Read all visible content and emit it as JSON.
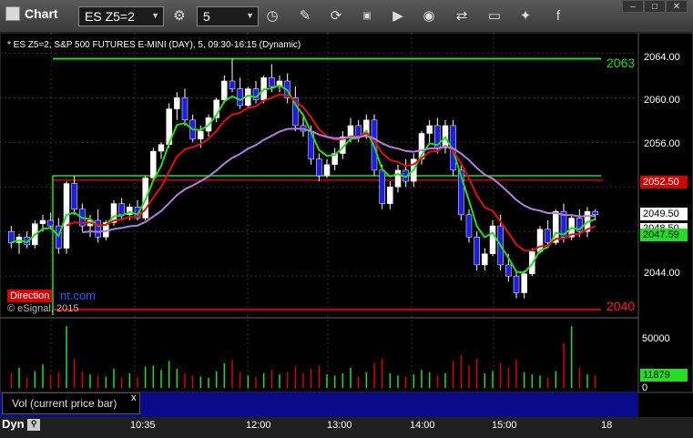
{
  "toolbar": {
    "title": "Chart",
    "symbol": "ES Z5=2",
    "interval": "5"
  },
  "chart": {
    "header": "* ES Z5=2, S&P 500 FUTURES E-MINI (DAY), 5, 09:30-16:15 (Dynamic)",
    "direction_label": "Direction",
    "direction_link": "nt.com",
    "copyright": "© eSignal, 2015",
    "right_labels": {
      "top": "2063",
      "bottom": "2040"
    },
    "price_axis": [
      "2064.00",
      "2060.00",
      "2056.00",
      "2044.00"
    ],
    "badges": [
      {
        "text": "2052.50",
        "bg": "#d40000",
        "fg": "#ffffff"
      },
      {
        "text": "2049.50",
        "bg": "#ffffff",
        "fg": "#000000"
      },
      {
        "text": "2048.50",
        "bg": "#ffffff",
        "fg": "#000000"
      },
      {
        "text": "2047.59",
        "bg": "#22dd22",
        "fg": "#000000"
      }
    ],
    "time_axis": [
      "10:35",
      "12:00",
      "13:00",
      "14:00",
      "15:00",
      "18"
    ]
  },
  "volume": {
    "label": "Vol (current price bar)",
    "close": "x",
    "axis": [
      "50000",
      "0"
    ],
    "badge": "11879"
  },
  "bottom": {
    "dyn": "Dyn"
  },
  "chart_data": {
    "type": "candlestick",
    "ylim": [
      2040.5,
      2065.5
    ],
    "candles": [
      [
        2048.0,
        2048.5,
        2046.5,
        2047.0
      ],
      [
        2047.0,
        2047.8,
        2046.0,
        2047.5
      ],
      [
        2047.5,
        2048.0,
        2046.5,
        2046.8
      ],
      [
        2046.8,
        2049.0,
        2046.5,
        2048.7
      ],
      [
        2048.7,
        2049.5,
        2048.0,
        2049.0
      ],
      [
        2049.0,
        2049.7,
        2048.2,
        2048.5
      ],
      [
        2048.5,
        2049.2,
        2046.0,
        2046.5
      ],
      [
        2046.5,
        2052.5,
        2046.0,
        2052.3
      ],
      [
        2052.3,
        2053.0,
        2049.5,
        2050.0
      ],
      [
        2050.0,
        2050.5,
        2048.0,
        2048.5
      ],
      [
        2048.5,
        2049.5,
        2047.5,
        2049.0
      ],
      [
        2049.0,
        2050.0,
        2047.0,
        2047.5
      ],
      [
        2047.5,
        2049.0,
        2047.2,
        2048.8
      ],
      [
        2048.8,
        2050.8,
        2048.5,
        2050.5
      ],
      [
        2050.5,
        2051.0,
        2049.0,
        2049.5
      ],
      [
        2049.5,
        2050.5,
        2049.0,
        2050.2
      ],
      [
        2050.2,
        2050.8,
        2049.0,
        2049.2
      ],
      [
        2049.2,
        2053.0,
        2049.0,
        2052.8
      ],
      [
        2052.8,
        2055.5,
        2052.5,
        2055.2
      ],
      [
        2055.2,
        2056.0,
        2054.5,
        2055.8
      ],
      [
        2055.8,
        2059.5,
        2055.5,
        2059.0
      ],
      [
        2059.0,
        2060.5,
        2058.0,
        2060.0
      ],
      [
        2060.0,
        2060.8,
        2057.5,
        2058.0
      ],
      [
        2058.0,
        2058.5,
        2056.0,
        2056.3
      ],
      [
        2056.3,
        2057.5,
        2055.5,
        2057.0
      ],
      [
        2057.0,
        2058.5,
        2056.5,
        2058.2
      ],
      [
        2058.2,
        2060.0,
        2057.8,
        2059.8
      ],
      [
        2059.8,
        2062.0,
        2059.5,
        2061.5
      ],
      [
        2061.5,
        2063.5,
        2060.5,
        2060.8
      ],
      [
        2060.8,
        2061.8,
        2059.0,
        2059.3
      ],
      [
        2059.3,
        2061.0,
        2059.0,
        2060.8
      ],
      [
        2060.8,
        2061.5,
        2059.5,
        2059.8
      ],
      [
        2059.8,
        2062.0,
        2059.5,
        2061.8
      ],
      [
        2061.8,
        2063.0,
        2060.5,
        2061.0
      ],
      [
        2061.0,
        2062.0,
        2060.5,
        2061.5
      ],
      [
        2061.5,
        2062.2,
        2059.5,
        2060.0
      ],
      [
        2060.0,
        2061.0,
        2057.0,
        2057.5
      ],
      [
        2057.5,
        2058.5,
        2056.5,
        2057.0
      ],
      [
        2057.0,
        2057.5,
        2054.0,
        2054.5
      ],
      [
        2054.5,
        2055.0,
        2052.5,
        2053.0
      ],
      [
        2053.0,
        2054.5,
        2052.8,
        2054.0
      ],
      [
        2054.0,
        2055.5,
        2053.5,
        2055.0
      ],
      [
        2055.0,
        2057.0,
        2054.5,
        2056.5
      ],
      [
        2056.5,
        2058.2,
        2056.0,
        2057.5
      ],
      [
        2057.5,
        2058.0,
        2056.0,
        2056.5
      ],
      [
        2056.5,
        2058.5,
        2056.3,
        2058.0
      ],
      [
        2058.0,
        2058.5,
        2053.0,
        2053.5
      ],
      [
        2053.5,
        2054.0,
        2050.0,
        2050.5
      ],
      [
        2050.5,
        2052.5,
        2050.0,
        2052.0
      ],
      [
        2052.0,
        2054.0,
        2051.5,
        2053.5
      ],
      [
        2053.5,
        2054.5,
        2052.0,
        2052.5
      ],
      [
        2052.5,
        2055.0,
        2052.0,
        2054.5
      ],
      [
        2054.5,
        2057.0,
        2054.0,
        2056.8
      ],
      [
        2056.8,
        2058.0,
        2056.0,
        2057.5
      ],
      [
        2057.5,
        2058.2,
        2055.0,
        2055.5
      ],
      [
        2055.5,
        2058.0,
        2055.0,
        2057.5
      ],
      [
        2057.5,
        2058.0,
        2053.0,
        2053.5
      ],
      [
        2053.5,
        2054.0,
        2049.0,
        2049.5
      ],
      [
        2049.5,
        2050.0,
        2047.0,
        2047.5
      ],
      [
        2047.5,
        2048.0,
        2044.5,
        2045.0
      ],
      [
        2045.0,
        2046.5,
        2044.5,
        2046.0
      ],
      [
        2046.0,
        2049.0,
        2045.8,
        2048.5
      ],
      [
        2048.5,
        2049.5,
        2044.5,
        2045.0
      ],
      [
        2045.0,
        2046.0,
        2043.5,
        2044.0
      ],
      [
        2044.0,
        2044.5,
        2042.0,
        2042.5
      ],
      [
        2042.5,
        2044.5,
        2042.0,
        2044.2
      ],
      [
        2044.2,
        2046.5,
        2044.0,
        2046.2
      ],
      [
        2046.2,
        2048.5,
        2046.0,
        2048.2
      ],
      [
        2048.2,
        2049.0,
        2046.5,
        2047.0
      ],
      [
        2047.0,
        2050.0,
        2046.8,
        2049.8
      ],
      [
        2049.8,
        2050.5,
        2047.0,
        2047.5
      ],
      [
        2047.5,
        2049.5,
        2047.2,
        2049.2
      ],
      [
        2049.2,
        2050.0,
        2047.5,
        2048.0
      ],
      [
        2048.0,
        2050.2,
        2047.5,
        2049.8
      ],
      [
        2049.8,
        2050.0,
        2049.0,
        2049.5
      ]
    ],
    "volume": [
      13000,
      18000,
      9000,
      15000,
      21000,
      12000,
      14000,
      55000,
      26000,
      15000,
      12000,
      11000,
      10000,
      17000,
      9000,
      13000,
      10000,
      19000,
      20000,
      16000,
      24000,
      17000,
      13000,
      11000,
      10000,
      9000,
      15000,
      22000,
      25000,
      14000,
      11000,
      10000,
      13000,
      16000,
      12000,
      14000,
      19000,
      13000,
      17000,
      20000,
      12000,
      11000,
      13000,
      18000,
      10000,
      14000,
      22000,
      26000,
      13000,
      11000,
      10000,
      12000,
      16000,
      14000,
      11000,
      13000,
      24000,
      29000,
      20000,
      26000,
      13000,
      15000,
      22000,
      18000,
      25000,
      14000,
      12000,
      11000,
      9000,
      15000,
      40000,
      55000,
      18000,
      12000,
      11000
    ],
    "volume_ylim": [
      0,
      60000
    ]
  }
}
